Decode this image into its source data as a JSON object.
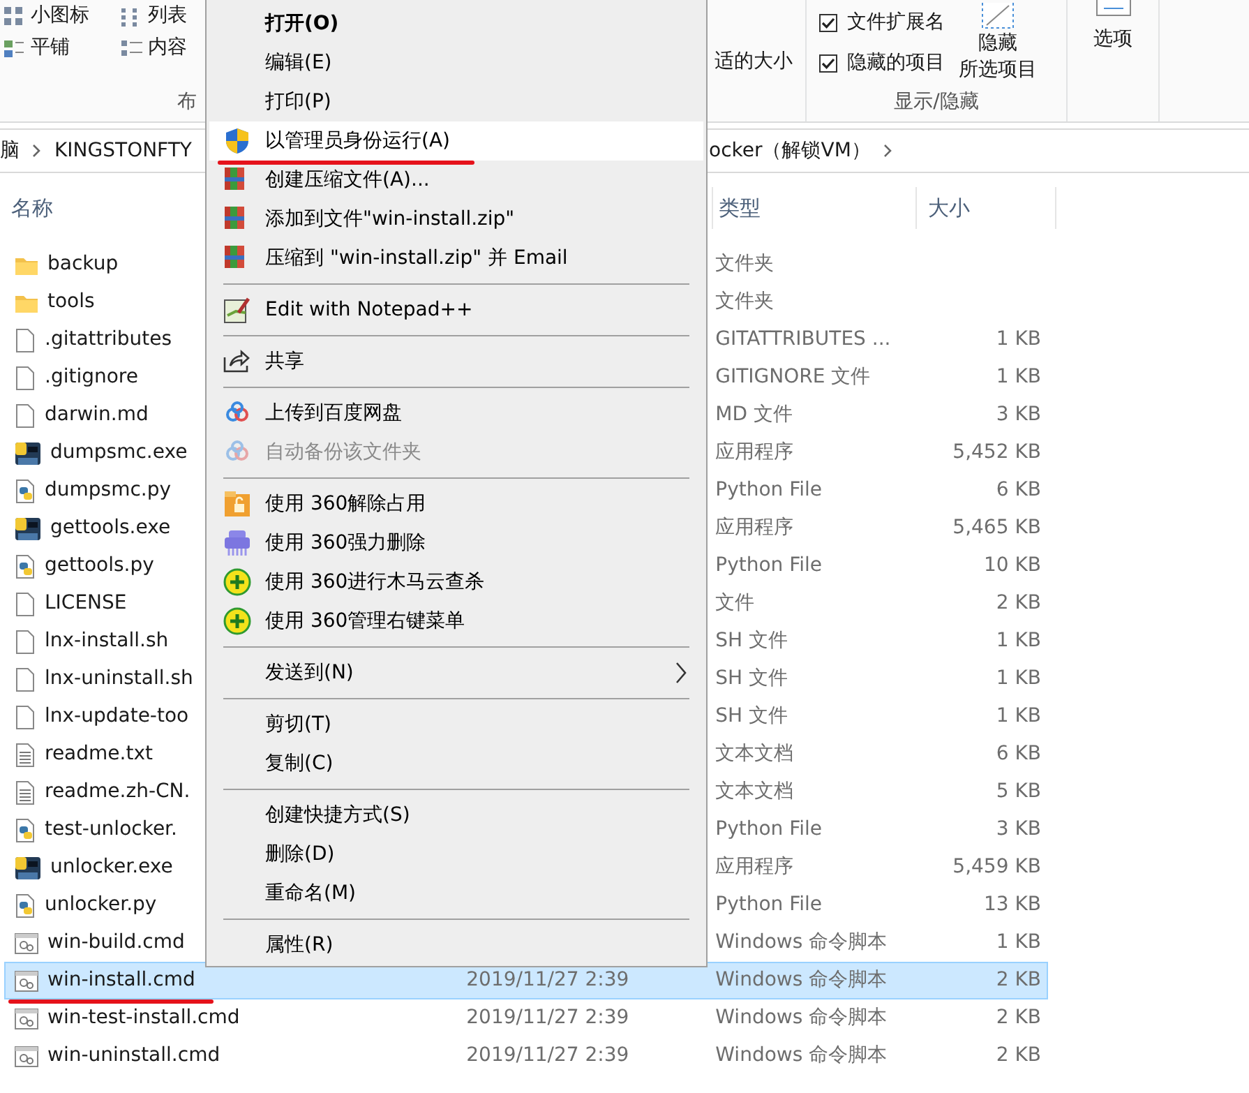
{
  "ribbon": {
    "layout_views": [
      {
        "label": "小图标"
      },
      {
        "label": "列表"
      },
      {
        "label": "平铺"
      },
      {
        "label": "内容"
      }
    ],
    "layout_group_label": "布",
    "size_columns_label": "适的大小",
    "show_hide": {
      "checkboxes": [
        {
          "label": "文件扩展名",
          "checked": true
        },
        {
          "label": "隐藏的项目",
          "checked": true
        }
      ],
      "hide_button": [
        "隐藏",
        "所选项目"
      ],
      "group_label": "显示/隐藏"
    },
    "options_button": "选项"
  },
  "breadcrumb": [
    {
      "label": "脑",
      "chevron": true
    },
    {
      "label": "KINGSTONFTY",
      "chevron": false
    },
    {
      "label": "ocker（解锁VM）",
      "chevron": true
    }
  ],
  "columns": {
    "name": "名称",
    "type": "类型",
    "size": "大小"
  },
  "rows": [
    {
      "name": "backup",
      "kind": "folder",
      "type": "文件夹",
      "selected": false,
      "annotated": false
    },
    {
      "name": "tools",
      "kind": "folder",
      "type": "文件夹",
      "selected": false,
      "annotated": false
    },
    {
      "name": ".gitattributes",
      "kind": "file",
      "type": "GITATTRIBUTES ...",
      "size": "1 KB",
      "selected": false,
      "annotated": false
    },
    {
      "name": ".gitignore",
      "kind": "file",
      "type": "GITIGNORE 文件",
      "size": "1 KB",
      "selected": false,
      "annotated": false
    },
    {
      "name": "darwin.md",
      "kind": "file",
      "type": "MD 文件",
      "size": "3 KB",
      "selected": false,
      "annotated": false
    },
    {
      "name": "dumpsmc.exe",
      "kind": "exe",
      "type": "应用程序",
      "size": "5,452 KB",
      "selected": false,
      "annotated": false
    },
    {
      "name": "dumpsmc.py",
      "kind": "py",
      "type": "Python File",
      "size": "6 KB",
      "selected": false,
      "annotated": false
    },
    {
      "name": "gettools.exe",
      "kind": "exe",
      "type": "应用程序",
      "size": "5,465 KB",
      "selected": false,
      "annotated": false
    },
    {
      "name": "gettools.py",
      "kind": "py",
      "type": "Python File",
      "size": "10 KB",
      "selected": false,
      "annotated": false
    },
    {
      "name": "LICENSE",
      "kind": "file",
      "type": "文件",
      "size": "2 KB",
      "selected": false,
      "annotated": false
    },
    {
      "name": "lnx-install.sh",
      "kind": "file",
      "type": "SH 文件",
      "size": "1 KB",
      "selected": false,
      "annotated": false
    },
    {
      "name": "lnx-uninstall.sh",
      "kind": "file",
      "type": "SH 文件",
      "size": "1 KB",
      "selected": false,
      "annotated": false
    },
    {
      "name": "lnx-update-too",
      "kind": "file",
      "type": "SH 文件",
      "size": "1 KB",
      "selected": false,
      "annotated": false
    },
    {
      "name": "readme.txt",
      "kind": "text",
      "type": "文本文档",
      "size": "6 KB",
      "selected": false,
      "annotated": false
    },
    {
      "name": "readme.zh-CN.",
      "kind": "text",
      "type": "文本文档",
      "size": "5 KB",
      "selected": false,
      "annotated": false
    },
    {
      "name": "test-unlocker.",
      "kind": "py",
      "type": "Python File",
      "size": "3 KB",
      "selected": false,
      "annotated": false
    },
    {
      "name": "unlocker.exe",
      "kind": "exe",
      "type": "应用程序",
      "size": "5,459 KB",
      "selected": false,
      "annotated": false
    },
    {
      "name": "unlocker.py",
      "kind": "py",
      "type": "Python File",
      "size": "13 KB",
      "selected": false,
      "annotated": false
    },
    {
      "name": "win-build.cmd",
      "kind": "cmd",
      "type": "Windows 命令脚本",
      "size": "1 KB",
      "selected": false,
      "annotated": false
    },
    {
      "name": "win-install.cmd",
      "kind": "cmd",
      "date": "2019/11/27 2:39",
      "type": "Windows 命令脚本",
      "size": "2 KB",
      "selected": true,
      "annotated": true
    },
    {
      "name": "win-test-install.cmd",
      "kind": "cmd",
      "date": "2019/11/27 2:39",
      "type": "Windows 命令脚本",
      "size": "2 KB",
      "selected": false,
      "annotated": false
    },
    {
      "name": "win-uninstall.cmd",
      "kind": "cmd",
      "date": "2019/11/27 2:39",
      "type": "Windows 命令脚本",
      "size": "2 KB",
      "selected": false,
      "annotated": false
    }
  ],
  "menu": [
    {
      "kind": "plain",
      "label": "打开(O)",
      "default": true,
      "selected": false,
      "disabled": false,
      "annotated": false
    },
    {
      "kind": "plain",
      "label": "编辑(E)",
      "default": false,
      "selected": false,
      "disabled": false,
      "annotated": false
    },
    {
      "kind": "plain",
      "label": "打印(P)",
      "default": false,
      "selected": false,
      "disabled": false,
      "annotated": false
    },
    {
      "kind": "admin",
      "label": "以管理员身份运行(A)",
      "default": false,
      "selected": true,
      "disabled": false,
      "annotated": true
    },
    {
      "kind": "archive",
      "label": "创建压缩文件(A)...",
      "default": false,
      "selected": false,
      "disabled": false,
      "annotated": false
    },
    {
      "kind": "archive",
      "label": "添加到文件\"win-install.zip\"",
      "default": false,
      "selected": false,
      "disabled": false,
      "annotated": false
    },
    {
      "kind": "archive",
      "label": "压缩到 \"win-install.zip\" 并 Email",
      "default": false,
      "selected": false,
      "disabled": false,
      "annotated": false
    },
    {
      "kind": "separator"
    },
    {
      "kind": "notepad",
      "label": "Edit with Notepad++",
      "default": false,
      "selected": false,
      "disabled": false,
      "annotated": false
    },
    {
      "kind": "separator"
    },
    {
      "kind": "share",
      "label": "共享",
      "default": false,
      "selected": false,
      "disabled": false,
      "annotated": false
    },
    {
      "kind": "separator"
    },
    {
      "kind": "cloud",
      "label": "上传到百度网盘",
      "default": false,
      "selected": false,
      "disabled": false,
      "annotated": false
    },
    {
      "kind": "cloud",
      "label": "自动备份该文件夹",
      "default": false,
      "selected": false,
      "disabled": true,
      "annotated": false
    },
    {
      "kind": "separator"
    },
    {
      "kind": "unlock",
      "label": "使用 360解除占用",
      "default": false,
      "selected": false,
      "disabled": false,
      "annotated": false
    },
    {
      "kind": "shred",
      "label": "使用 360强力删除",
      "default": false,
      "selected": false,
      "disabled": false,
      "annotated": false
    },
    {
      "kind": "scan",
      "label": "使用 360进行木马云查杀",
      "default": false,
      "selected": false,
      "disabled": false,
      "annotated": false
    },
    {
      "kind": "scan",
      "label": "使用 360管理右键菜单",
      "default": false,
      "selected": false,
      "disabled": false,
      "annotated": false
    },
    {
      "kind": "separator"
    },
    {
      "kind": "submenu",
      "label": "发送到(N)",
      "default": false,
      "selected": false,
      "disabled": false,
      "annotated": false
    },
    {
      "kind": "separator"
    },
    {
      "kind": "plain",
      "label": "剪切(T)",
      "default": false,
      "selected": false,
      "disabled": false,
      "annotated": false
    },
    {
      "kind": "plain",
      "label": "复制(C)",
      "default": false,
      "selected": false,
      "disabled": false,
      "annotated": false
    },
    {
      "kind": "separator"
    },
    {
      "kind": "plain",
      "label": "创建快捷方式(S)",
      "default": false,
      "selected": false,
      "disabled": false,
      "annotated": false
    },
    {
      "kind": "plain",
      "label": "删除(D)",
      "default": false,
      "selected": false,
      "disabled": false,
      "annotated": false
    },
    {
      "kind": "plain",
      "label": "重命名(M)",
      "default": false,
      "selected": false,
      "disabled": false,
      "annotated": false
    },
    {
      "kind": "separator"
    },
    {
      "kind": "plain",
      "label": "属性(R)",
      "default": false,
      "selected": false,
      "disabled": false,
      "annotated": false
    }
  ]
}
